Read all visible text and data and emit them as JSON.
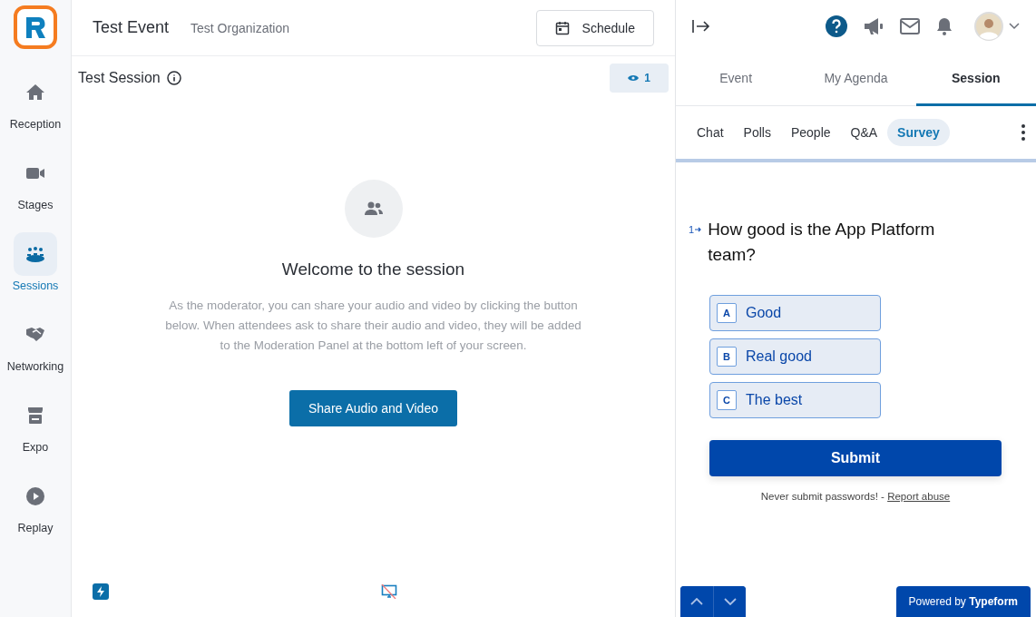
{
  "sidebar": {
    "items": [
      {
        "label": "Reception",
        "kind": "home",
        "selected": false
      },
      {
        "label": "Stages",
        "kind": "camera",
        "selected": false
      },
      {
        "label": "Sessions",
        "kind": "group",
        "selected": true
      },
      {
        "label": "Networking",
        "kind": "handshake",
        "selected": false
      },
      {
        "label": "Expo",
        "kind": "booth",
        "selected": false
      },
      {
        "label": "Replay",
        "kind": "play",
        "selected": false
      }
    ]
  },
  "header": {
    "event_title": "Test Event",
    "organization": "Test Organization",
    "schedule_button": "Schedule"
  },
  "session": {
    "title": "Test Session",
    "viewer_count": "1",
    "welcome_title": "Welcome to the session",
    "welcome_text": "As the moderator, you can share your audio and video by clicking the button below. When attendees ask to share their audio and video, they will be added to the Moderation Panel at the bottom left of your screen.",
    "share_button": "Share Audio and Video"
  },
  "right_panel": {
    "tabs": [
      {
        "label": "Event",
        "selected": false
      },
      {
        "label": "My Agenda",
        "selected": false
      },
      {
        "label": "Session",
        "selected": true
      }
    ],
    "subtabs": [
      {
        "label": "Chat",
        "selected": false
      },
      {
        "label": "Polls",
        "selected": false
      },
      {
        "label": "People",
        "selected": false
      },
      {
        "label": "Q&A",
        "selected": false
      },
      {
        "label": "Survey",
        "selected": true
      }
    ],
    "survey": {
      "question_number": "1",
      "question": "How good is the App Platform team?",
      "options": [
        {
          "key": "A",
          "label": "Good",
          "selected": false
        },
        {
          "key": "B",
          "label": "Real good",
          "selected": false
        },
        {
          "key": "C",
          "label": "The best",
          "selected": false
        }
      ],
      "submit": "Submit",
      "notice": "Never submit passwords! - ",
      "report_link": "Report abuse",
      "powered_by": "Powered by **Typeform**"
    }
  }
}
